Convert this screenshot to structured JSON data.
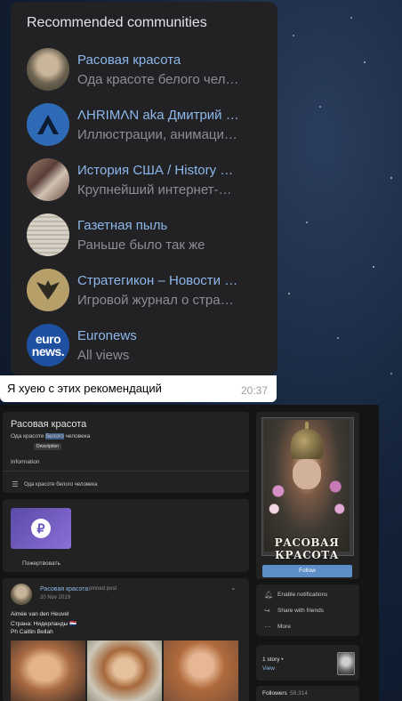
{
  "recommended": {
    "title": "Recommended communities",
    "items": [
      {
        "name": "Расовая красота",
        "subtitle": "Ода красоте белого чел…"
      },
      {
        "name": "ΛHRIMΛN aka Дмитрий …",
        "subtitle": "Иллюстрации, анимаци…"
      },
      {
        "name": "История США / History …",
        "subtitle": "Крупнейший интернет-…"
      },
      {
        "name": "Газетная пыль",
        "subtitle": "Раньше было так же"
      },
      {
        "name": "Стратегикон – Новости …",
        "subtitle": "Игровой журнал о стра…"
      },
      {
        "name": "Euronews",
        "subtitle": "All views"
      }
    ],
    "euronews_logo": [
      "euro",
      "news."
    ]
  },
  "message": {
    "text": "Я хуею с этих рекомендаций",
    "time": "20:37"
  },
  "group_page": {
    "title": "Расовая красота",
    "status_before": "Ода красоте ",
    "status_highlight": "белого",
    "status_after": " человека",
    "tooltip": "Description",
    "information_label": "Information",
    "description": "Ода красоте белого человека",
    "donate_label": "Пожертвовать",
    "donate_symbol": "₽",
    "cover_title": "РАСОВАЯ КРАСОТА",
    "follow_label": "Follow",
    "actions": [
      {
        "icon": "bell-icon",
        "label": "Enable notifications"
      },
      {
        "icon": "share-icon",
        "label": "Share with friends"
      },
      {
        "icon": "more-icon",
        "label": "More"
      }
    ],
    "story_count": "1 story •",
    "story_view": "View",
    "followers_label": "Followers",
    "followers_count": "58,314",
    "post": {
      "author": "Расовая красота",
      "pinned": "pinned post",
      "date": "20 Nov 2019",
      "line1": "Aimée van den Heuvel",
      "line2": "Страна: Нидерланды 🇳🇱",
      "line3": "Ph Caitlin Bellah"
    }
  }
}
